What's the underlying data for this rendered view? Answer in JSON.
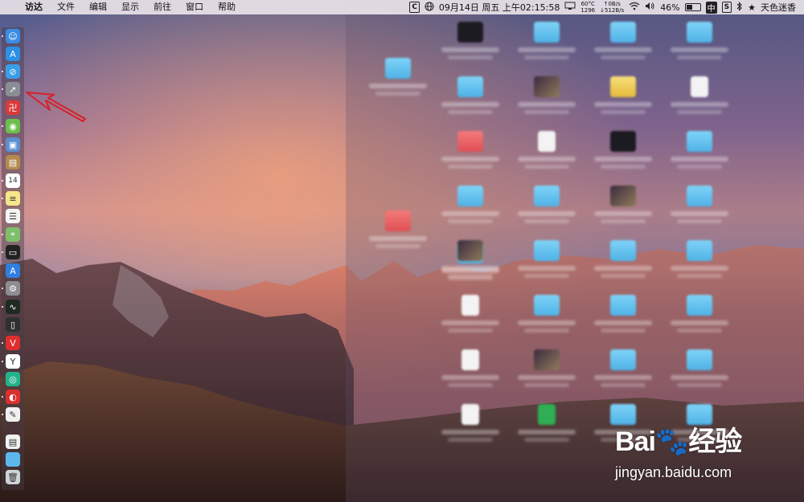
{
  "menubar": {
    "apple_glyph": "",
    "items": [
      "访达",
      "文件",
      "编辑",
      "显示",
      "前往",
      "窗口",
      "帮助"
    ],
    "status": {
      "c_badge": "C",
      "datetime": "09月14日 周五 上午02:15:58",
      "temp_top": "60°C",
      "temp_bottom": "1296",
      "net_up": "↑0B/s",
      "net_down": "↓512B/s",
      "battery_pct": "46%",
      "battery_level": 0.46,
      "ime": "中",
      "s_badge": "S",
      "star": "★",
      "user": "天色迷香"
    }
  },
  "dock": {
    "items": [
      {
        "name": "finder",
        "icon": "finder-icon",
        "color": "#3b8de3",
        "glyph": "☺"
      },
      {
        "name": "app-store",
        "icon": "app-store-icon",
        "color": "#2d8fe6",
        "glyph": "A"
      },
      {
        "name": "safari",
        "icon": "safari-icon",
        "color": "#3a9de8",
        "glyph": "⊘"
      },
      {
        "name": "launchpad",
        "icon": "launchpad-icon",
        "color": "#8a8e96",
        "glyph": "➚"
      },
      {
        "name": "app-red",
        "icon": "red-app-icon",
        "color": "#d93a3a",
        "glyph": "卍"
      },
      {
        "name": "android",
        "icon": "android-icon",
        "color": "#6cc04a",
        "glyph": "◉"
      },
      {
        "name": "preview",
        "icon": "preview-icon",
        "color": "#5b8fd0",
        "glyph": "▣"
      },
      {
        "name": "notebook",
        "icon": "notebook-icon",
        "color": "#b48a4e",
        "glyph": "▤"
      },
      {
        "name": "calendar",
        "icon": "calendar-icon",
        "color": "#ffffff",
        "glyph": "14"
      },
      {
        "name": "notes",
        "icon": "notes-icon",
        "color": "#f7e58a",
        "glyph": "≡"
      },
      {
        "name": "reminders",
        "icon": "reminders-icon",
        "color": "#f4f4f4",
        "glyph": "☰"
      },
      {
        "name": "maps",
        "icon": "maps-icon",
        "color": "#7dbf6b",
        "glyph": "⌖"
      },
      {
        "name": "terminal",
        "icon": "terminal-icon",
        "color": "#222222",
        "glyph": "▭"
      },
      {
        "name": "app-store-2",
        "icon": "app-store-blue-icon",
        "color": "#2f7fe0",
        "glyph": "A"
      },
      {
        "name": "system-preferences",
        "icon": "gear-icon",
        "color": "#8d8d92",
        "glyph": "⚙"
      },
      {
        "name": "activity-monitor",
        "icon": "activity-monitor-icon",
        "color": "#1f2a20",
        "glyph": "∿"
      },
      {
        "name": "console",
        "icon": "console-icon",
        "color": "#303030",
        "glyph": "▯"
      },
      {
        "name": "vivaldi",
        "icon": "vivaldi-icon",
        "color": "#e02d2d",
        "glyph": "V"
      },
      {
        "name": "yandex",
        "icon": "yandex-icon",
        "color": "#ffffff",
        "glyph": "Y"
      },
      {
        "name": "wechat-green",
        "icon": "green-app-icon",
        "color": "#23b38a",
        "glyph": "◎"
      },
      {
        "name": "netease-music",
        "icon": "netease-music-icon",
        "color": "#d93030",
        "glyph": "◐"
      },
      {
        "name": "script-editor",
        "icon": "script-editor-icon",
        "color": "#f1f1f1",
        "glyph": "✎"
      },
      {
        "name": "document",
        "icon": "document-icon",
        "color": "#f1f1f1",
        "glyph": "▤"
      },
      {
        "name": "folder",
        "icon": "folder-icon",
        "color": "#5cb8ec",
        "glyph": ""
      },
      {
        "name": "trash",
        "icon": "trash-icon",
        "color": "#cfd3d8",
        "glyph": "🗑"
      }
    ]
  },
  "desktop": {
    "icons": [
      {
        "kind": "folder"
      },
      {
        "kind": "folder-red"
      },
      {
        "kind": "folder"
      },
      {
        "kind": "dark"
      },
      {
        "kind": "folder"
      },
      {
        "kind": "folder"
      },
      {
        "kind": "folder"
      },
      {
        "kind": "folder-red"
      },
      {
        "kind": "folder"
      },
      {
        "kind": "photo"
      },
      {
        "kind": "folder-yellow"
      },
      {
        "kind": "doc"
      },
      {
        "kind": "purple"
      },
      {
        "kind": "folder-red"
      },
      {
        "kind": "doc"
      },
      {
        "kind": "dark"
      },
      {
        "kind": "folder"
      },
      {
        "kind": "doc"
      },
      {
        "kind": "folder"
      },
      {
        "kind": "folder"
      },
      {
        "kind": "photo"
      },
      {
        "kind": "folder"
      },
      {
        "kind": "photo"
      },
      {
        "kind": "photo"
      },
      {
        "kind": "folder"
      },
      {
        "kind": "folder"
      },
      {
        "kind": "folder"
      },
      {
        "kind": "folder"
      },
      {
        "kind": "doc"
      },
      {
        "kind": "folder"
      },
      {
        "kind": "folder"
      },
      {
        "kind": "folder"
      },
      {
        "kind": "purple"
      },
      {
        "kind": "doc"
      },
      {
        "kind": "photo"
      },
      {
        "kind": "folder"
      },
      {
        "kind": "folder"
      },
      {
        "kind": "photo"
      },
      {
        "kind": "doc"
      },
      {
        "kind": "green"
      },
      {
        "kind": "folder"
      },
      {
        "kind": "folder"
      },
      {
        "kind": "dark"
      }
    ]
  },
  "watermark": {
    "logo_text": "Bai🐾经验",
    "url": "jingyan.baidu.com"
  },
  "colors": {
    "arrow": "#d8202a",
    "menubar_bg": "#f0e8ec"
  }
}
